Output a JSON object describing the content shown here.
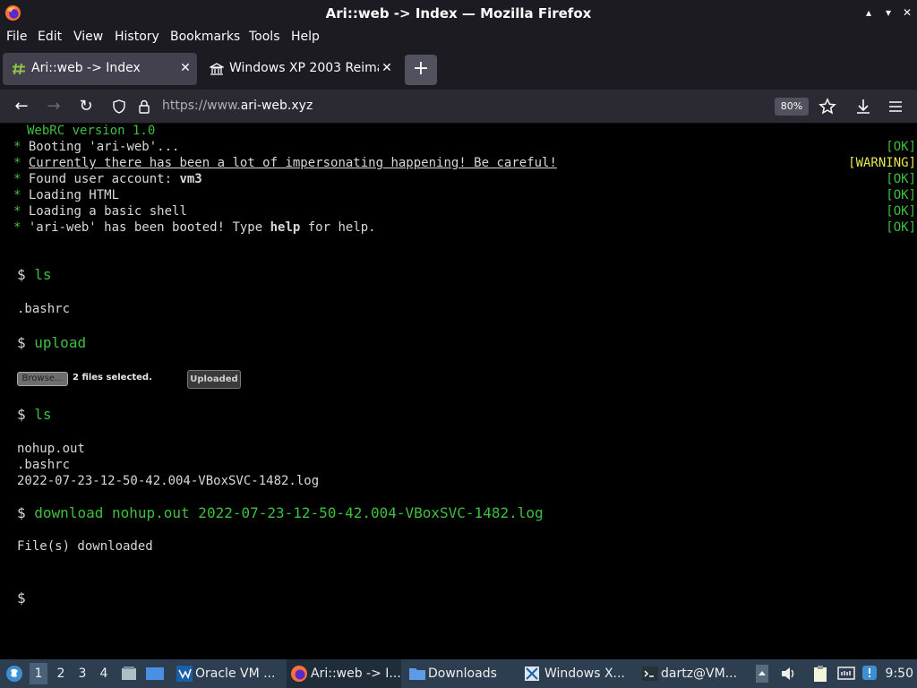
{
  "window": {
    "title": "Ari::web -> Index — Mozilla Firefox",
    "controls": [
      "▴",
      "▾",
      "✕"
    ]
  },
  "menu": [
    "File",
    "Edit",
    "View",
    "History",
    "Bookmarks",
    "Tools",
    "Help"
  ],
  "tabs": [
    {
      "label": "Ari::web -> Index",
      "icon": "hash-icon",
      "active": true,
      "close": "✕"
    },
    {
      "label": "Windows XP 2003 Reima",
      "icon": "museum-icon",
      "active": false,
      "close": "✕"
    }
  ],
  "newtab": "+",
  "nav": {
    "back": "←",
    "forward": "→",
    "reload": "↻",
    "url_prefix": "https://www.",
    "url_domain": "ari-web.xyz",
    "zoom": "80%"
  },
  "terminal": {
    "version": "WebRC version 1.0",
    "boot_lines": [
      {
        "bullet": "*",
        "text": "Booting 'ari-web'...",
        "status": "[OK]"
      },
      {
        "bullet": "*",
        "text": "Currently there has been a lot of impersonating happening! Be careful!",
        "status": "[WARNING]"
      },
      {
        "bullet": "*",
        "text": "Found user account: ",
        "bold": "vm3",
        "status": "[OK]"
      },
      {
        "bullet": "*",
        "text": "Loading HTML",
        "status": "[OK]"
      },
      {
        "bullet": "*",
        "text": "Loading a basic shell",
        "status": "[OK]"
      },
      {
        "bullet": "*",
        "text": "'ari-web' has been booted! Type ",
        "bold": "help",
        "text_after": " for help.",
        "status": "[OK]"
      }
    ],
    "prompt": "$",
    "cmd1": "ls",
    "out1": ".bashrc",
    "cmd2": "upload",
    "browse_label": "Browse...",
    "files_selected": "2 files selected.",
    "uploaded_label": "Uploaded",
    "cmd3": "ls",
    "out3": [
      "nohup.out",
      ".bashrc",
      "2022-07-23-12-50-42.004-VBoxSVC-1482.log"
    ],
    "cmd4": "download nohup.out 2022-07-23-12-50-42.004-VBoxSVC-1482.log",
    "out4": "File(s) downloaded",
    "prompt_final": "$"
  },
  "taskbar": {
    "workspaces": [
      "1",
      "2",
      "3",
      "4"
    ],
    "items": [
      {
        "label": "Oracle VM ...",
        "icon": "virtualbox-icon"
      },
      {
        "label": "Ari::web -> I...",
        "icon": "firefox-icon",
        "active": true
      },
      {
        "label": "Downloads",
        "icon": "folder-icon"
      },
      {
        "label": "Windows X...",
        "icon": "windows-xp-icon"
      },
      {
        "label": "dartz@VM...",
        "icon": "terminal-icon"
      }
    ],
    "clock": "9:50"
  },
  "colors": {
    "accent_green": "#3fbf3f",
    "warning_yellow": "#e6e64c",
    "taskbar": "#2c3e50",
    "titlebar": "#1c1b22"
  }
}
